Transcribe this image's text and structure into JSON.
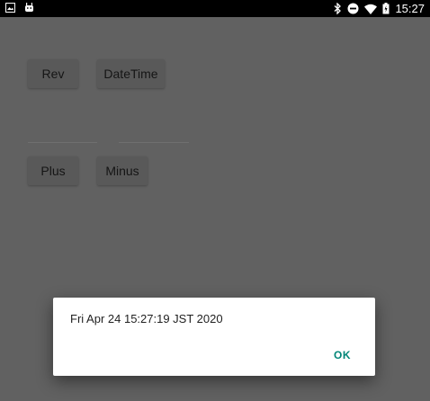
{
  "status_bar": {
    "time": "15:27",
    "left_icons": [
      "image-icon",
      "android-icon"
    ],
    "right_icons": [
      "bluetooth-icon",
      "do-not-disturb-icon",
      "wifi-icon",
      "battery-icon"
    ]
  },
  "buttons": {
    "rev": "Rev",
    "datetime": "DateTime",
    "plus": "Plus",
    "minus": "Minus"
  },
  "dialog": {
    "message": "Fri Apr 24 15:27:19 JST 2020",
    "ok": "OK"
  },
  "colors": {
    "scrim": "#616161",
    "accent": "#008577",
    "status_bar": "#000000"
  }
}
